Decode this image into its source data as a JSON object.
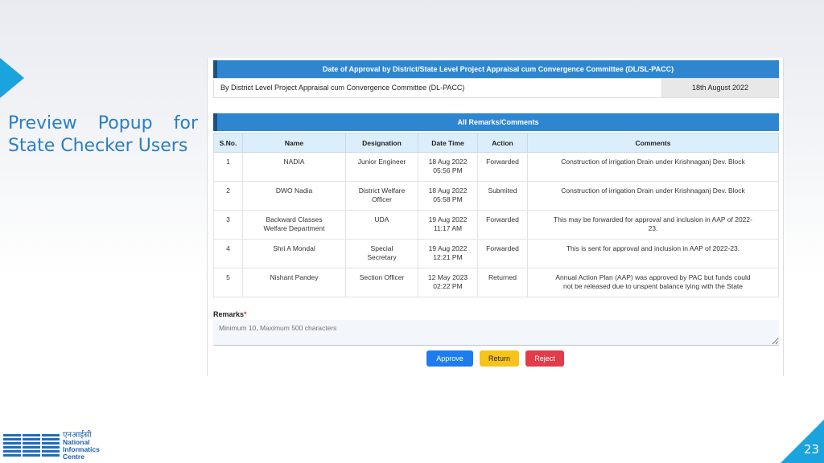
{
  "slide": {
    "title_words": [
      "Preview",
      "Popup",
      "for"
    ],
    "title_line2": "State Checker Users",
    "page_number": "23",
    "logo": {
      "hindi": "एनआईसी",
      "line1": "National",
      "line2": "Informatics",
      "line3": "Centre"
    }
  },
  "approval": {
    "header": "Date of Approval by District/State Level Project Appraisal cum Convergence Committee (DL/SL-PACC)",
    "label": "By District Level Project Appraisal cum Convergence Committee (DL-PACC)",
    "date": "18th August 2022"
  },
  "remarks_section": {
    "header": "All Remarks/Comments",
    "columns": [
      "S.No.",
      "Name",
      "Designation",
      "Date Time",
      "Action",
      "Comments"
    ],
    "rows": [
      [
        "1",
        "NADIA",
        "Junior Engineer",
        "18 Aug 2022\n05:56 PM",
        "Forwarded",
        "Construction of irrigation Drain under Krishnaganj Dev. Block"
      ],
      [
        "2",
        "DWO Nadia",
        "District Welfare\nOfficer",
        "18 Aug 2022\n05:58 PM",
        "Submited",
        "Construction of irrigation Drain under Krishnaganj Dev. Block"
      ],
      [
        "3",
        "Backward Classes\nWelfare Department",
        "UDA",
        "19 Aug 2022\n11:17 AM",
        "Forwarded",
        "This may be forwarded for approval and inclusion in AAP of 2022-\n23."
      ],
      [
        "4",
        "Shri A Mondal",
        "Special\nSecretary",
        "19 Aug 2022\n12:21 PM",
        "Forwarded",
        "This is sent for approval and inclusion in AAP of 2022-23."
      ],
      [
        "5",
        "Nishant Pandey",
        "Section Officer",
        "12 May 2023\n02:22 PM",
        "Returned",
        "Annual Action Plan (AAP) was approved by PAC but funds could\nnot be released due to unspent balance lying with the State"
      ]
    ]
  },
  "form": {
    "remarks_label": "Remarks",
    "required_mark": "*",
    "remarks_placeholder": "Minimum 10, Maximum 500 characters",
    "approve_label": "Approve",
    "return_label": "Return",
    "reject_label": "Reject"
  }
}
